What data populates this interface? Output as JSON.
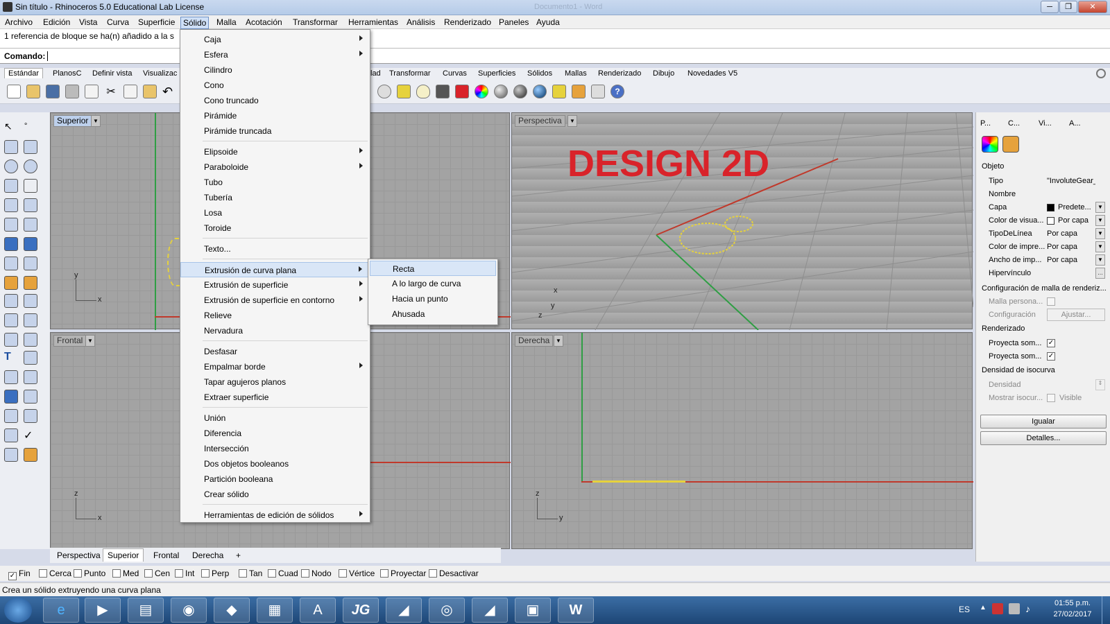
{
  "window": {
    "title": "Sin título - Rhinoceros 5.0 Educational Lab License",
    "ghost_title": "Documento1 - Word"
  },
  "menubar": [
    "Archivo",
    "Edición",
    "Vista",
    "Curva",
    "Superficie",
    "Sólido",
    "Malla",
    "Acotación",
    "Transformar",
    "Herramientas",
    "Análisis",
    "Renderizado",
    "Paneles",
    "Ayuda"
  ],
  "command": {
    "history": "1 referencia de bloque se ha(n) añadido a la s",
    "prompt": "Comando:"
  },
  "toolbar_tabs": [
    "Estándar",
    "PlanosC",
    "Definir vista",
    "Visualizac",
    "lad",
    "Transformar",
    "Curvas",
    "Superficies",
    "Sólidos",
    "Mallas",
    "Renderizado",
    "Dibujo",
    "Novedades V5"
  ],
  "viewports": {
    "top": {
      "label": "Superior",
      "axis_a": "y",
      "axis_b": "x"
    },
    "perspective": {
      "label": "Perspectiva",
      "overlay": "DESIGN 2D",
      "axis_a": "x",
      "axis_b": "y",
      "axis_c": "z"
    },
    "front": {
      "label": "Frontal",
      "axis_a": "z",
      "axis_b": "x"
    },
    "right": {
      "label": "Derecha",
      "axis_a": "z",
      "axis_b": "y"
    }
  },
  "view_tabs": [
    "Perspectiva",
    "Superior",
    "Frontal",
    "Derecha",
    "+"
  ],
  "solid_menu": {
    "group1": [
      "Caja",
      "Esfera",
      "Cilindro",
      "Cono",
      "Cono truncado",
      "Pirámide",
      "Pirámide truncada"
    ],
    "group2": [
      "Elipsoide",
      "Paraboloide",
      "Tubo",
      "Tubería",
      "Losa",
      "Toroide"
    ],
    "group3": [
      "Texto..."
    ],
    "group4": [
      "Extrusión de curva plana",
      "Extrusión de superficie",
      "Extrusión de superficie en contorno",
      "Relieve",
      "Nervadura"
    ],
    "group5": [
      "Desfasar",
      "Empalmar borde",
      "Tapar agujeros planos",
      "Extraer superficie"
    ],
    "group6": [
      "Unión",
      "Diferencia",
      "Intersección",
      "Dos objetos booleanos",
      "Partición booleana",
      "Crear sólido"
    ],
    "group7": [
      "Herramientas de edición de sólidos"
    ]
  },
  "submenu": [
    "Recta",
    "A lo largo de curva",
    "Hacia un punto",
    "Ahusada"
  ],
  "osnaps": [
    {
      "label": "Fin",
      "checked": true
    },
    {
      "label": "Cerca",
      "checked": false
    },
    {
      "label": "Punto",
      "checked": false
    },
    {
      "label": "Med",
      "checked": false
    },
    {
      "label": "Cen",
      "checked": false
    },
    {
      "label": "Int",
      "checked": false
    },
    {
      "label": "Perp",
      "checked": false
    },
    {
      "label": "Tan",
      "checked": false
    },
    {
      "label": "Cuad",
      "checked": false
    },
    {
      "label": "Nodo",
      "checked": false
    },
    {
      "label": "Vértice",
      "checked": false
    },
    {
      "label": "Proyectar",
      "checked": false
    },
    {
      "label": "Desactivar",
      "checked": false
    }
  ],
  "status": "Crea un sólido extruyendo una curva plana",
  "panel": {
    "tabs": [
      "P...",
      "C...",
      "Vi...",
      "A..."
    ],
    "sections": {
      "object": "Objeto",
      "mesh": "Configuración de malla de renderiz...",
      "render": "Renderizado",
      "iso": "Densidad de isocurva"
    },
    "rows": [
      {
        "k": "Tipo",
        "v": "\"InvoluteGear_..."
      },
      {
        "k": "Nombre",
        "v": ""
      },
      {
        "k": "Capa",
        "v": "Predete..."
      },
      {
        "k": "Color de visua...",
        "v": "Por capa"
      },
      {
        "k": "TipoDeLínea",
        "v": "Por capa"
      },
      {
        "k": "Color de impre...",
        "v": "Por capa"
      },
      {
        "k": "Ancho de imp...",
        "v": "Por capa"
      },
      {
        "k": "Hipervínculo",
        "v": ""
      }
    ],
    "mesh_rows": [
      {
        "k": "Malla persona..."
      },
      {
        "k": "Configuración",
        "v": "Ajustar..."
      }
    ],
    "render_rows": [
      {
        "k": "Proyecta som..."
      },
      {
        "k": "Proyecta som..."
      }
    ],
    "iso_rows": [
      {
        "k": "Densidad"
      },
      {
        "k": "Mostrar isocur...",
        "v": "Visible"
      }
    ],
    "buttons": [
      "Igualar",
      "Detalles..."
    ]
  },
  "taskbar": {
    "lang": "ES",
    "time": "01:55 p.m.",
    "date": "27/02/2017",
    "jg": "JG"
  },
  "colors": {
    "accent": "#d9232a",
    "gear": "#e6d23c",
    "axis_red": "#c0392b",
    "axis_green": "#2f9e44"
  }
}
